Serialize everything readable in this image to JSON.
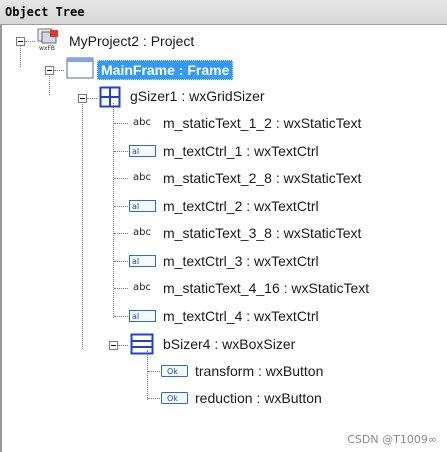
{
  "panel": {
    "title": "Object Tree"
  },
  "tree": {
    "project": {
      "label": "MyProject2 : Project",
      "icon": "wxfb-project-icon"
    },
    "frame": {
      "label": "MainFrame : Frame",
      "icon": "frame-window-icon",
      "selected": true
    },
    "grid_sizer": {
      "label": "gSizer1 : wxGridSizer",
      "icon": "grid-sizer-icon",
      "children": [
        {
          "label": "m_staticText_1_2 : wxStaticText",
          "icon": "static-text-icon",
          "icon_text": "abc"
        },
        {
          "label": "m_textCtrl_1 : wxTextCtrl",
          "icon": "text-ctrl-icon",
          "icon_text": "aI"
        },
        {
          "label": "m_staticText_2_8 : wxStaticText",
          "icon": "static-text-icon",
          "icon_text": "abc"
        },
        {
          "label": "m_textCtrl_2 : wxTextCtrl",
          "icon": "text-ctrl-icon",
          "icon_text": "aI"
        },
        {
          "label": "m_staticText_3_8 : wxStaticText",
          "icon": "static-text-icon",
          "icon_text": "abc"
        },
        {
          "label": "m_textCtrl_3 : wxTextCtrl",
          "icon": "text-ctrl-icon",
          "icon_text": "aI"
        },
        {
          "label": "m_staticText_4_16 : wxStaticText",
          "icon": "static-text-icon",
          "icon_text": "abc"
        },
        {
          "label": "m_textCtrl_4 : wxTextCtrl",
          "icon": "text-ctrl-icon",
          "icon_text": "aI"
        }
      ]
    },
    "box_sizer": {
      "label": "bSizer4 : wxBoxSizer",
      "icon": "box-sizer-icon",
      "children": [
        {
          "label": "transform : wxButton",
          "icon": "button-icon",
          "icon_text": "Ok"
        },
        {
          "label": "reduction : wxButton",
          "icon": "button-icon",
          "icon_text": "Ok"
        }
      ]
    }
  },
  "watermark": "CSDN @T1009∞",
  "colors": {
    "selection": "#3399ff",
    "grid_icon": "#1f3fd6",
    "header_bg": "#d9d9d9"
  }
}
